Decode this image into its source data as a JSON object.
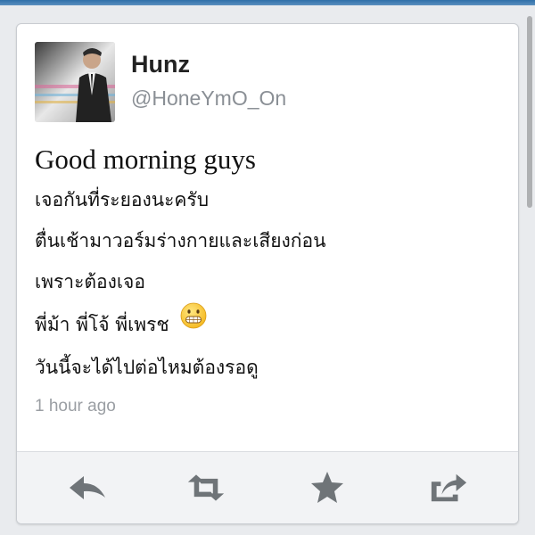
{
  "user": {
    "name": "Hunz",
    "handle": "@HoneYmO_On"
  },
  "tweet": {
    "lines": [
      "Good morning guys",
      "เจอกันที่ระยองนะครับ",
      "ตื่นเช้ามาวอร์มร่างกายและเสียงก่อน",
      "เพราะต้องเจอ",
      "พี่ม้า พี่โจ้ พี่เพรช",
      "วันนี้จะได้ไปต่อไหมต้องรอดู"
    ],
    "emoji": "grinning-face-emoji",
    "timestamp": "1 hour ago"
  },
  "actions": [
    {
      "name": "reply",
      "icon": "reply-icon"
    },
    {
      "name": "retweet",
      "icon": "retweet-icon"
    },
    {
      "name": "favorite",
      "icon": "star-icon"
    },
    {
      "name": "share",
      "icon": "share-icon"
    }
  ],
  "colors": {
    "background": "#e9ebee",
    "card": "#ffffff",
    "name_text": "#222222",
    "secondary_text": "#8a8f95",
    "action_bar": "#f2f3f5",
    "action_icon": "#6f7478"
  }
}
